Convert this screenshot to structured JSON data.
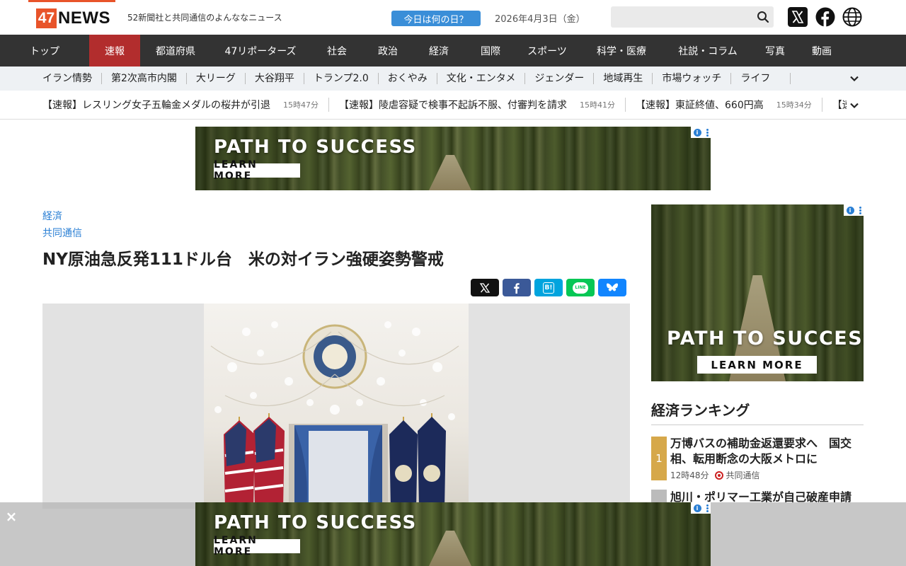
{
  "header": {
    "logo_num": "47",
    "logo_text": "NEWS",
    "tagline": "52新聞社と共同通信のよんななニュース",
    "today_button": "今日は何の日？",
    "date": "2026年4月3日（金）",
    "search_placeholder": ""
  },
  "nav": {
    "items": [
      {
        "label": "トップ",
        "active": false
      },
      {
        "label": "速報",
        "active": true
      },
      {
        "label": "都道府県",
        "active": false
      },
      {
        "label": "47リポーターズ",
        "active": false
      },
      {
        "label": "社会",
        "active": false
      },
      {
        "label": "政治",
        "active": false
      },
      {
        "label": "経済",
        "active": false
      },
      {
        "label": "国際",
        "active": false
      },
      {
        "label": "スポーツ",
        "active": false
      },
      {
        "label": "科学・医療",
        "active": false
      },
      {
        "label": "社説・コラム",
        "active": false
      },
      {
        "label": "写真",
        "active": false
      },
      {
        "label": "動画",
        "active": false
      }
    ]
  },
  "subnav": {
    "items": [
      "イラン情勢",
      "第2次高市内閣",
      "大リーグ",
      "大谷翔平",
      "トランプ2.0",
      "おくやみ",
      "文化・エンタメ",
      "ジェンダー",
      "地域再生",
      "市場ウォッチ",
      "ライフ"
    ]
  },
  "ticker": {
    "items": [
      {
        "text": "【速報】レスリング女子五輪金メダルの桜井が引退",
        "time": "15時47分"
      },
      {
        "text": "【速報】陵虐容疑で検事不起訴不服、付審判を請求",
        "time": "15時41分"
      },
      {
        "text": "【速報】東証終値、660円高",
        "time": "15時34分"
      },
      {
        "text": "【速",
        "time": ""
      }
    ]
  },
  "ads": {
    "title": "PATH TO SUCCESS",
    "button": "LEARN MORE",
    "info": "i"
  },
  "article": {
    "category": "経済",
    "source": "共同通信",
    "headline": "NY原油急反発111ドル台　米の対イラン強硬姿勢警戒",
    "share": [
      {
        "name": "x",
        "color": "#111111"
      },
      {
        "name": "facebook",
        "color": "#3b5998"
      },
      {
        "name": "hatena",
        "color": "#00a4de",
        "label": "B!"
      },
      {
        "name": "line",
        "color": "#06c755",
        "label": "LINE"
      },
      {
        "name": "bluesky",
        "color": "#1185fe"
      }
    ]
  },
  "sidebar": {
    "ranking_title": "経済ランキング",
    "ranking": [
      {
        "rank": "1",
        "title": "万博バスの補助金返還要求へ　国交相、転用断念の大阪メトロに",
        "time": "12時48分",
        "source": "共同通信"
      },
      {
        "rank": "",
        "title": "旭川・ポリマー工業が自己破産申請",
        "time": "",
        "source": ""
      }
    ]
  },
  "bottom": {
    "close": "×"
  },
  "colors": {
    "brand": "#e8542a",
    "nav_bg": "#333333",
    "nav_active": "#b22d2d",
    "link": "#2a7fd4",
    "rank_gold": "#d6a84a"
  }
}
